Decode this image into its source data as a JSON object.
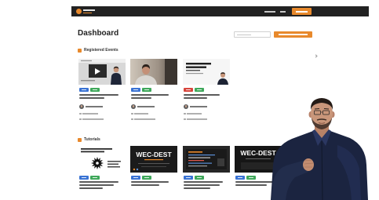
{
  "theme": {
    "accent": "#e8892c",
    "header_background": "#222222",
    "tag_blue": "#3a73d4",
    "tag_green": "#3fa85b",
    "tag_red": "#d7453c"
  },
  "header": {
    "logo_icon": "logo-emblem-icon"
  },
  "page": {
    "title": "Dashboard"
  },
  "sections": [
    {
      "title": "Registered Events",
      "icon": "section-bullet-icon",
      "nav_icon": "chevron-right-icon",
      "cards": [
        {
          "tags": [
            "blue",
            "green"
          ]
        },
        {
          "tags": [
            "blue",
            "green"
          ]
        },
        {
          "tags": [
            "red",
            "green"
          ]
        }
      ]
    },
    {
      "title": "Tutorials",
      "icon": "section-bullet-icon",
      "cards": [
        {
          "tags": [
            "blue",
            "green"
          ]
        },
        {
          "tags": [
            "blue",
            "green"
          ],
          "thumbnail_text": "WEC-DEST"
        },
        {
          "tags": [
            "blue",
            "green"
          ]
        },
        {
          "tags": [
            "blue",
            "green"
          ],
          "thumbnail_text": "WEC-DEST"
        }
      ]
    }
  ]
}
